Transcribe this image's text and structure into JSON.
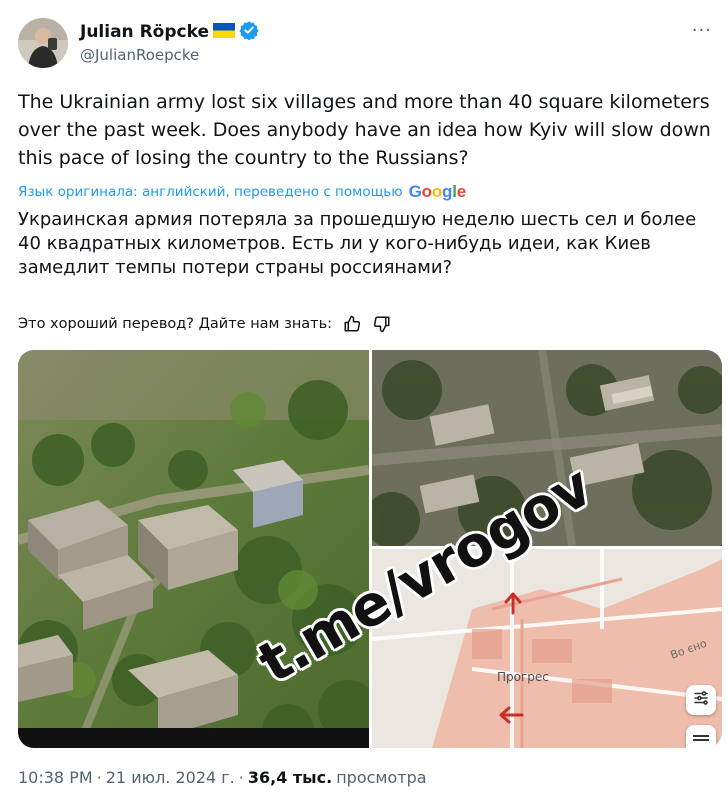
{
  "author": {
    "display_name": "Julian Röpcke",
    "handle": "@JulianRoepcke",
    "flag_icon": "ukraine-flag-icon",
    "verified_icon": "verified-badge-icon",
    "verified_color": "#1d9bf0"
  },
  "more_label": "···",
  "tweet": {
    "text": "The Ukrainian army lost six villages and more than 40 square kilometers over the past week. Does anybody have an idea how Kyiv will slow down this pace of losing the country to the Russians?",
    "translation_note": "Язык оригинала: английский, переведено с помощью",
    "translation_service": "Google",
    "translated_text": "Украинская армия потеряла за прошедшую неделю шесть сел и более 40 квадратных километров. Есть ли у кого-нибудь идеи, как Киев замедлит темпы потери страны россиянами?",
    "feedback_prompt": "Это хороший перевод? Дайте нам знать:"
  },
  "media": {
    "watermark": "t.me/vrogov",
    "map_labels": {
      "village": "Прогрес",
      "road": "Во єно"
    }
  },
  "meta": {
    "time": "10:38 PM",
    "separator": "·",
    "date": "21 июл. 2024 г.",
    "views_count": "36,4 тыс.",
    "views_label": "просмотра"
  },
  "colors": {
    "link": "#1d9bf0",
    "text": "#0f1419",
    "secondary": "#536471"
  }
}
